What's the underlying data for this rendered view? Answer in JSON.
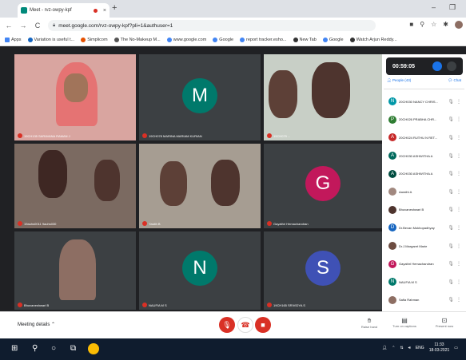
{
  "browser": {
    "tab_title": "Meet - rvz-owpy-kpf",
    "tab_close": "×",
    "new_tab": "+",
    "url": "meet.google.com/rvz-owpy-kpf?pli=1&authuser=1",
    "bookmarks": [
      "Apps",
      "Variation is useful t...",
      "Simplicom",
      "The No-Makeup M...",
      "www.google.com",
      "Google",
      "report tracker.esho...",
      "New Tab",
      "Google",
      "Watch Arjun Reddy..."
    ]
  },
  "tiles": [
    {
      "name": "19CH135 SARAVANA RAMAN J",
      "avatar": ""
    },
    {
      "name": "19CH078 MARINA MARIAM KURIAN",
      "avatar": "M",
      "color": "#00796b"
    },
    {
      "name": "19CH079 ...",
      "avatar": ""
    },
    {
      "name": "19auhs0011 9auhs030",
      "avatar": ""
    },
    {
      "name": "Yasith B",
      "avatar": ""
    },
    {
      "name": "Gayathri Hemachandran",
      "avatar": "G",
      "color": "#c2185b"
    },
    {
      "name": "Bhuvaneshwari B",
      "avatar": ""
    },
    {
      "name": "NAUFIA M S",
      "avatar": "N",
      "color": "#00796b"
    },
    {
      "name": "19CH165 SRIVIDYA S",
      "avatar": "S",
      "color": "#3f51b5"
    }
  ],
  "panel": {
    "timer": "00:59:05",
    "people_tab": "People (43)",
    "chat_tab": "Chat",
    "participants": [
      {
        "name": "20CH030 NANCY CHRIS...",
        "initial": "N",
        "color": "#0097a7"
      },
      {
        "name": "20CH026 PRABHA CHR...",
        "initial": "P",
        "color": "#2e7d32"
      },
      {
        "name": "20CH024 RUTHU N RET...",
        "initial": "A",
        "color": "#c62828"
      },
      {
        "name": "20CH030 ASHWITHA A",
        "initial": "A",
        "color": "#00695c"
      },
      {
        "name": "20CH030 ASHWITHA A",
        "initial": "A",
        "color": "#004d40"
      },
      {
        "name": "Aarathi A",
        "initial": "",
        "color": "#a1887f"
      },
      {
        "name": "Bhuvaneshwari B",
        "initial": "",
        "color": "#4e342e"
      },
      {
        "name": "Dr.Bevan Mukhopadhyay",
        "initial": "D",
        "color": "#1565c0"
      },
      {
        "name": "Dr.J.Margaret Marie",
        "initial": "",
        "color": "#6d4c41"
      },
      {
        "name": "Gayathri Hemachandran",
        "initial": "G",
        "color": "#c2185b"
      },
      {
        "name": "NAUFIA M S",
        "initial": "N",
        "color": "#00796b"
      },
      {
        "name": "Safia Rahman",
        "initial": "",
        "color": "#8d6e63"
      }
    ]
  },
  "bottom": {
    "meeting_details": "Meeting details",
    "raise_hand": "Raise hand",
    "captions": "Turn on captions",
    "present": "Present now"
  },
  "taskbar": {
    "time": "11:33",
    "date": "18-03-2021",
    "lang": "ENG"
  }
}
